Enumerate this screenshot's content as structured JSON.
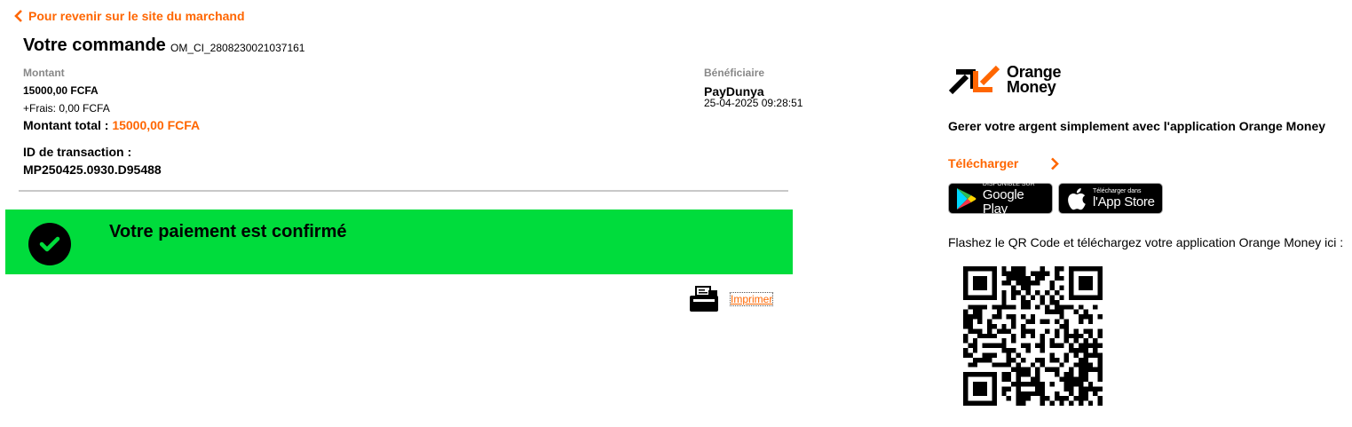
{
  "back_link": "Pour revenir sur le site du marchand",
  "order": {
    "title": "Votre commande",
    "id": "OM_CI_2808230021037161",
    "amount_label": "Montant",
    "amount": "15000,00 FCFA",
    "fees": "+Frais: 0,00 FCFA",
    "total_label": "Montant total :",
    "total_value": "15000,00 FCFA",
    "transaction_label": "ID de transaction :",
    "transaction_id": "MP250425.0930.D95488"
  },
  "beneficiary": {
    "label": "Bénéficiaire",
    "name": "PayDunya",
    "datetime": "25-04-2025 09:28:51"
  },
  "confirmation": {
    "message": "Votre paiement est confirmé",
    "color": "#00dc3c"
  },
  "print_label": "Imprimer",
  "promo": {
    "brand_line1": "Orange",
    "brand_line2": "Money",
    "tagline": "Gerer votre argent simplement avec l'application Orange Money",
    "download_label": "Télécharger",
    "google_play_small": "DISPONIBLE SUR",
    "google_play_big": "Google Play",
    "app_store_small": "Télécharger dans",
    "app_store_big": "l'App Store",
    "qr_caption": "Flashez le QR Code et téléchargez votre application Orange Money ici :"
  },
  "colors": {
    "accent": "#ff6600"
  }
}
